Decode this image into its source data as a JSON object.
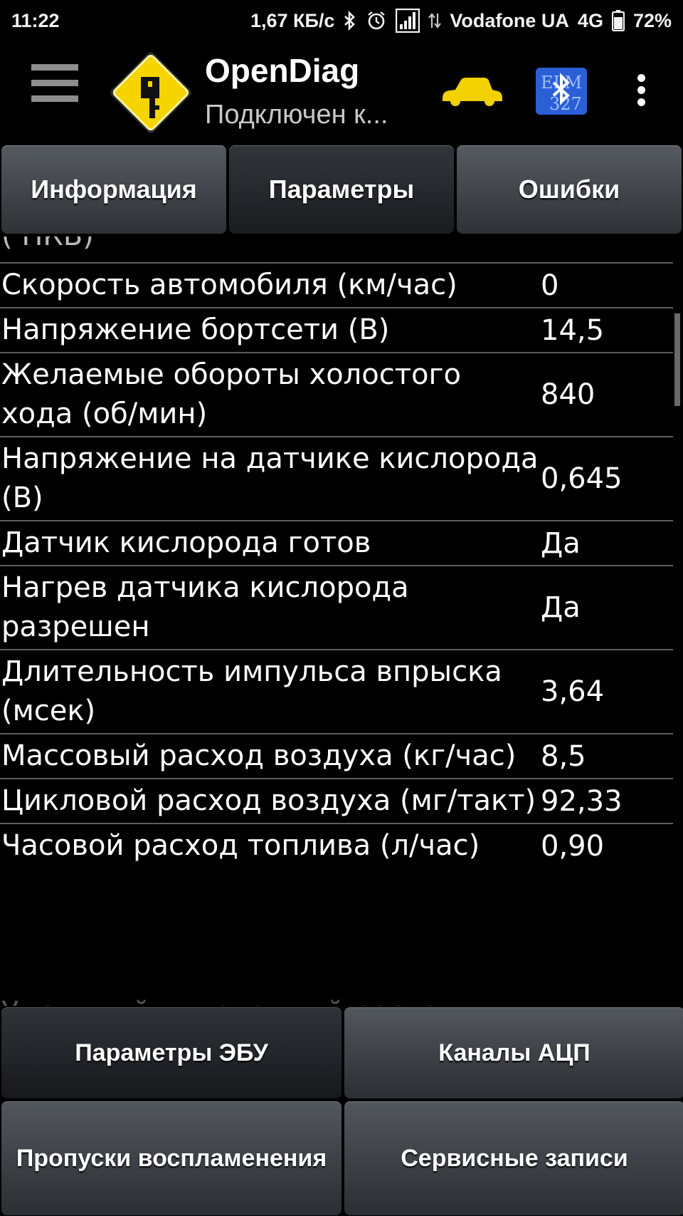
{
  "status_bar": {
    "time": "11:22",
    "speed": "1,67 КБ/с",
    "carrier": "Vodafone UA",
    "network": "4G",
    "battery": "72%",
    "icons": [
      "bluetooth-icon",
      "alarm-icon",
      "signal-icon",
      "data-arrows-icon",
      "battery-icon"
    ]
  },
  "app_bar": {
    "title": "OpenDiag",
    "subtitle": "Подключен к...",
    "icons": [
      "menu-icon",
      "app-logo-icon",
      "car-icon",
      "bluetooth-adapter-icon",
      "overflow-menu-icon"
    ],
    "colors": {
      "car": "#f2d100",
      "logo": "#f5d400",
      "bt_badge": "#2a5fd6"
    }
  },
  "tabs": [
    {
      "label": "Информация",
      "active": false
    },
    {
      "label": "Параметры",
      "active": true
    },
    {
      "label": "Ошибки",
      "active": false
    }
  ],
  "parameters": {
    "partial_top": "( ПКВ)",
    "rows": [
      {
        "name": "Скорость автомобиля (км/час)",
        "value": "0"
      },
      {
        "name": "Напряжение бортсети (В)",
        "value": "14,5"
      },
      {
        "name": "Желаемые обороты холостого хода (об/мин)",
        "value": "840"
      },
      {
        "name": "Напряжение на датчике кислорода (В)",
        "value": "0,645"
      },
      {
        "name": "Датчик кислорода готов",
        "value": "Да"
      },
      {
        "name": "Нагрев датчика кислорода разрешен",
        "value": "Да"
      },
      {
        "name": "Длительность импульса впрыска (мсек)",
        "value": "3,64"
      },
      {
        "name": "Массовый расход воздуха (кг/час)",
        "value": "8,5"
      },
      {
        "name": "Цикловой расход воздуха (мг/такт)",
        "value": "92,33"
      },
      {
        "name": "Часовой расход топлива (л/час)",
        "value": "0,90"
      }
    ],
    "partial_bottom": "Удельный мгновенный расход"
  },
  "bottom_buttons": [
    {
      "label": "Параметры ЭБУ",
      "active": true
    },
    {
      "label": "Каналы АЦП",
      "active": false
    },
    {
      "label": "Пропуски воспламенения",
      "active": false
    },
    {
      "label": "Сервисные записи",
      "active": false
    }
  ]
}
